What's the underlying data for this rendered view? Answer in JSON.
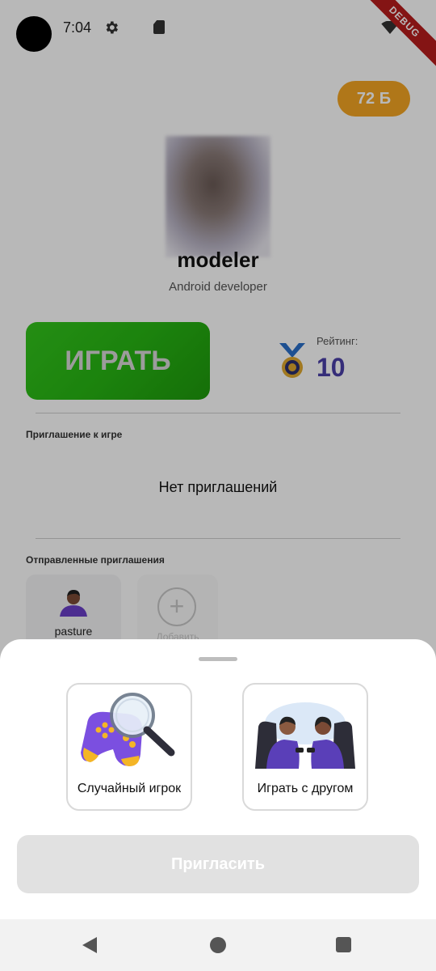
{
  "status_bar": {
    "time": "7:04",
    "debug_banner": "DEBUG",
    "icons": [
      "camera-hole",
      "gear-icon",
      "sd-card-icon",
      "wifi-icon"
    ]
  },
  "profile": {
    "points_badge": "72 Б",
    "username": "modeler",
    "role": "Android developer",
    "play_button": "ИГРАТЬ",
    "rating_label": "Рейтинг:",
    "rating_value": "10"
  },
  "invitations": {
    "section_label": "Приглашение к игре",
    "empty_text": "Нет приглашений"
  },
  "sent_invitations": {
    "section_label": "Отправленные приглашения",
    "items": [
      {
        "name": "pasture"
      }
    ],
    "add_label": "Добавить"
  },
  "sheet": {
    "options": [
      {
        "label": "Случайный игрок",
        "icon": "gamepad-magnifier-icon"
      },
      {
        "label": "Играть с другом",
        "icon": "two-gamers-icon"
      }
    ],
    "invite_button": "Пригласить"
  },
  "colors": {
    "play_green": "#27b613",
    "rating_purple": "#4a3fa8",
    "points_orange": "#f4a623",
    "disabled_button": "#e1e1e1"
  }
}
